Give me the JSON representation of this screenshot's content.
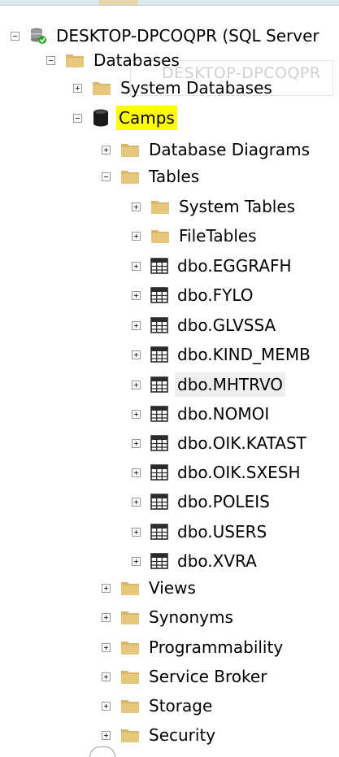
{
  "window": {
    "ghost_text": "DESKTOP-DPCOQPR"
  },
  "tree": {
    "server": {
      "label": "DESKTOP-DPCOQPR (SQL Server",
      "icon": "server-connected-icon",
      "expanded": true
    },
    "databases": {
      "label": "Databases",
      "icon": "folder-icon",
      "expanded": true
    },
    "system_databases": {
      "label": "System Databases",
      "icon": "folder-icon",
      "expanded": false
    },
    "camps": {
      "label": "Camps",
      "icon": "database-icon",
      "expanded": true,
      "highlight_color": "#ffff00"
    },
    "camps_children": [
      {
        "label": "Database Diagrams",
        "icon": "folder-icon",
        "expanded": false
      },
      {
        "label": "Tables",
        "icon": "folder-icon",
        "expanded": true
      },
      {
        "label": "Views",
        "icon": "folder-icon",
        "expanded": false
      },
      {
        "label": "Synonyms",
        "icon": "folder-icon",
        "expanded": false
      },
      {
        "label": "Programmability",
        "icon": "folder-icon",
        "expanded": false
      },
      {
        "label": "Service Broker",
        "icon": "folder-icon",
        "expanded": false
      },
      {
        "label": "Storage",
        "icon": "folder-icon",
        "expanded": false
      },
      {
        "label": "Security",
        "icon": "folder-icon",
        "expanded": false
      }
    ],
    "tables_children": [
      {
        "label": "System Tables",
        "icon": "folder-icon"
      },
      {
        "label": "FileTables",
        "icon": "folder-icon"
      },
      {
        "label": "dbo.EGGRAFH",
        "icon": "table-icon"
      },
      {
        "label": "dbo.FYLO",
        "icon": "table-icon"
      },
      {
        "label": "dbo.GLVSSA",
        "icon": "table-icon"
      },
      {
        "label": "dbo.KIND_MEMB",
        "icon": "table-icon"
      },
      {
        "label": "dbo.MHTRVO",
        "icon": "table-icon",
        "selected": true
      },
      {
        "label": "dbo.NOMOI",
        "icon": "table-icon"
      },
      {
        "label": "dbo.OIK.KATAST",
        "icon": "table-icon"
      },
      {
        "label": "dbo.OIK.SXESH",
        "icon": "table-icon"
      },
      {
        "label": "dbo.POLEIS",
        "icon": "table-icon"
      },
      {
        "label": "dbo.USERS",
        "icon": "table-icon"
      },
      {
        "label": "dbo.XVRA",
        "icon": "table-icon"
      }
    ]
  },
  "colors": {
    "folder": "#dcb567",
    "database": "#1a1a1a",
    "table_grid": "#2b2b2b",
    "highlight": "#ffff00",
    "selected_row": "#eeeeee"
  }
}
